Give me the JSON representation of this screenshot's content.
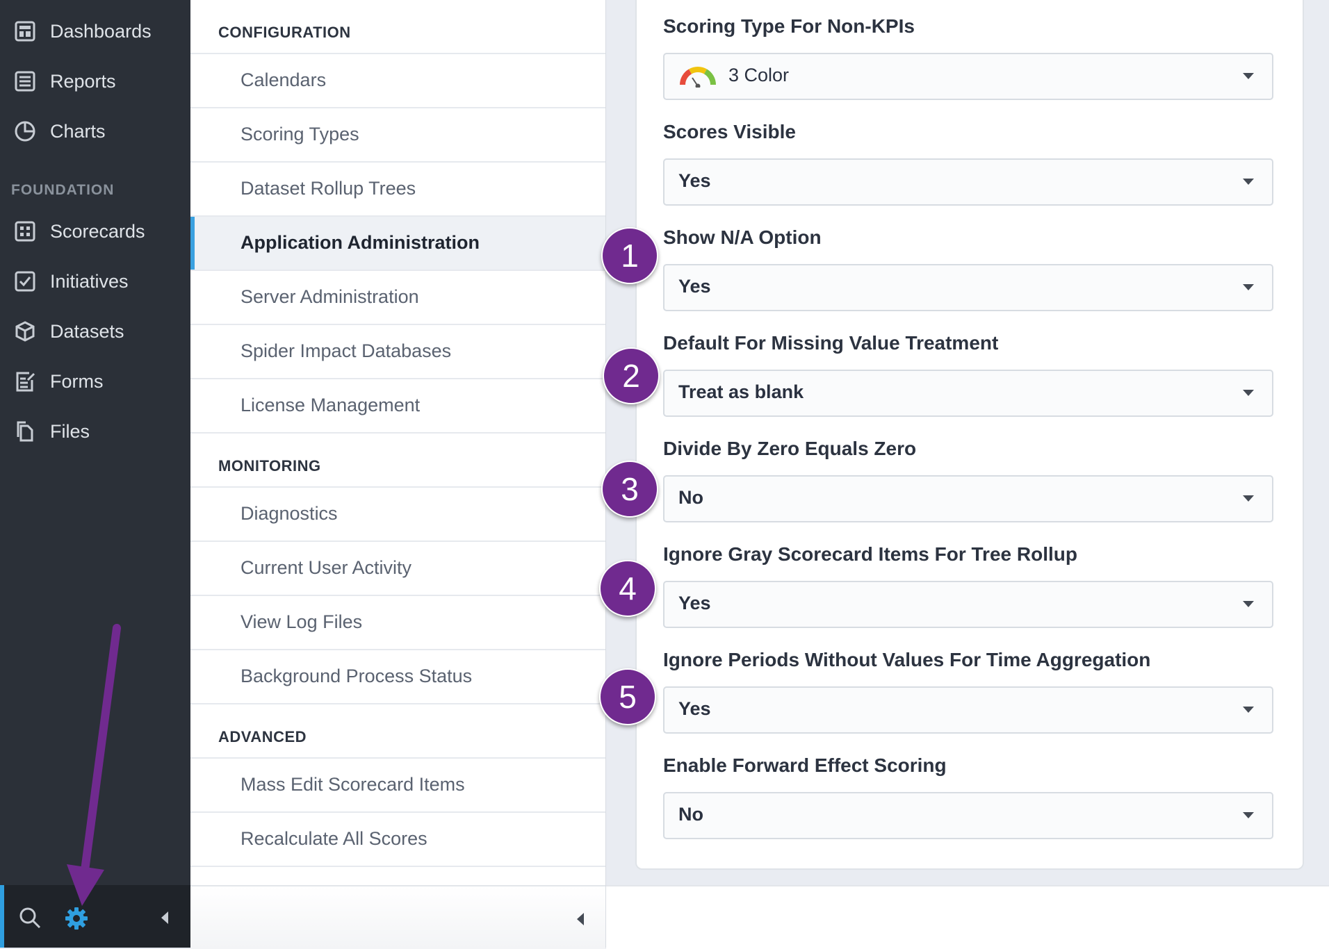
{
  "nav": {
    "items": [
      {
        "label": "Dashboards",
        "icon": "dashboard-icon"
      },
      {
        "label": "Reports",
        "icon": "report-icon"
      },
      {
        "label": "Charts",
        "icon": "pie-chart-icon"
      }
    ],
    "section": "FOUNDATION",
    "foundation_items": [
      {
        "label": "Scorecards",
        "icon": "scorecard-icon"
      },
      {
        "label": "Initiatives",
        "icon": "checkbox-icon"
      },
      {
        "label": "Datasets",
        "icon": "cube-icon"
      },
      {
        "label": "Forms",
        "icon": "form-icon"
      },
      {
        "label": "Files",
        "icon": "files-icon"
      }
    ],
    "bottom": {
      "search_icon": "search-icon",
      "settings_icon": "gear-icon",
      "collapse_icon": "collapse-left-icon"
    }
  },
  "menu": {
    "sections": [
      {
        "title": "CONFIGURATION",
        "items": [
          "Calendars",
          "Scoring Types",
          "Dataset Rollup Trees",
          "Application Administration",
          "Server Administration",
          "Spider Impact Databases",
          "License Management"
        ]
      },
      {
        "title": "MONITORING",
        "items": [
          "Diagnostics",
          "Current User Activity",
          "View Log Files",
          "Background Process Status"
        ]
      },
      {
        "title": "ADVANCED",
        "items": [
          "Mass Edit Scorecard Items",
          "Recalculate All Scores"
        ]
      }
    ],
    "active": "Application Administration"
  },
  "settings": {
    "fields": [
      {
        "label": "Scoring Type For Non-KPIs",
        "value": "3 Color",
        "icon": "gauge-icon"
      },
      {
        "label": "Scores Visible",
        "value": "Yes"
      },
      {
        "label": "Show N/A Option",
        "value": "Yes"
      },
      {
        "label": "Default For Missing Value Treatment",
        "value": "Treat as blank"
      },
      {
        "label": "Divide By Zero Equals Zero",
        "value": "No"
      },
      {
        "label": "Ignore Gray Scorecard Items For Tree Rollup",
        "value": "Yes"
      },
      {
        "label": "Ignore Periods Without Values For Time Aggregation",
        "value": "Yes"
      },
      {
        "label": "Enable Forward Effect Scoring",
        "value": "No"
      }
    ]
  },
  "annotations": {
    "badges": [
      "1",
      "2",
      "3",
      "4",
      "5"
    ],
    "badge_color": "#702a8f",
    "arrow_color": "#702a8f"
  },
  "colors": {
    "nav_bg": "#2b3038",
    "accent": "#3aa1e0"
  }
}
